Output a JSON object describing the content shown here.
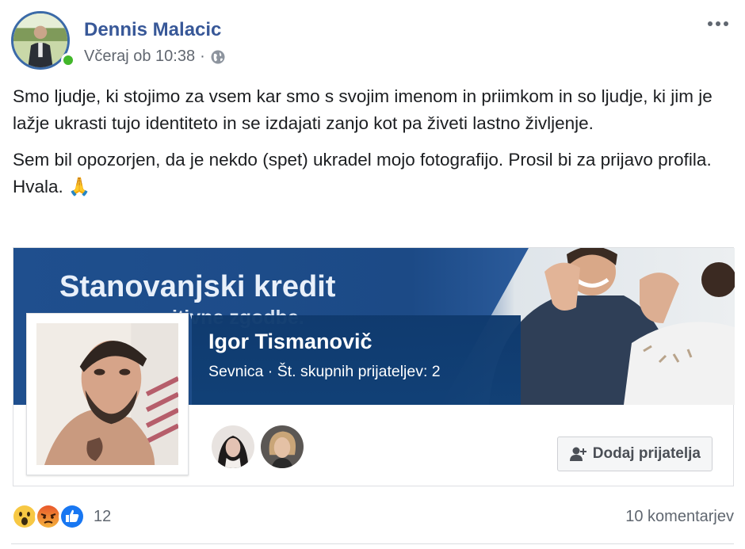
{
  "post": {
    "author": "Dennis Malacic",
    "time": "Včeraj ob 10:38",
    "separator": "·",
    "audience_icon": "globe-icon",
    "paragraph1": "Smo ljudje, ki stojimo za vsem kar smo s svojim imenom in priimkom in so ljudje, ki jim je lažje ukrasti tujo identiteto in se izdajati zanjo kot pa živeti lastno življenje.",
    "paragraph2": "Sem bil opozorjen, da je nekdo (spet) ukradel mojo fotografijo. Prosil bi za prijavo profila. Hvala.",
    "paragraph2_emoji": "🙏"
  },
  "shared_profile": {
    "cover_line1": "Stanovanjski kredit",
    "cover_line2": "itivne zgodbe.",
    "name": "Igor Tismanovič",
    "subtitle": "Sevnica · Št. skupnih prijateljev: 2",
    "add_friend_label": "Dodaj prijatelja"
  },
  "footer": {
    "reaction_count": "12",
    "comments": "10 komentarjev",
    "reactions": [
      "wow-reaction-icon",
      "angry-reaction-icon",
      "like-reaction-icon"
    ]
  },
  "colors": {
    "author_name": "#385898",
    "cover_blue": "#1f4f8e",
    "online": "#42b72a"
  }
}
